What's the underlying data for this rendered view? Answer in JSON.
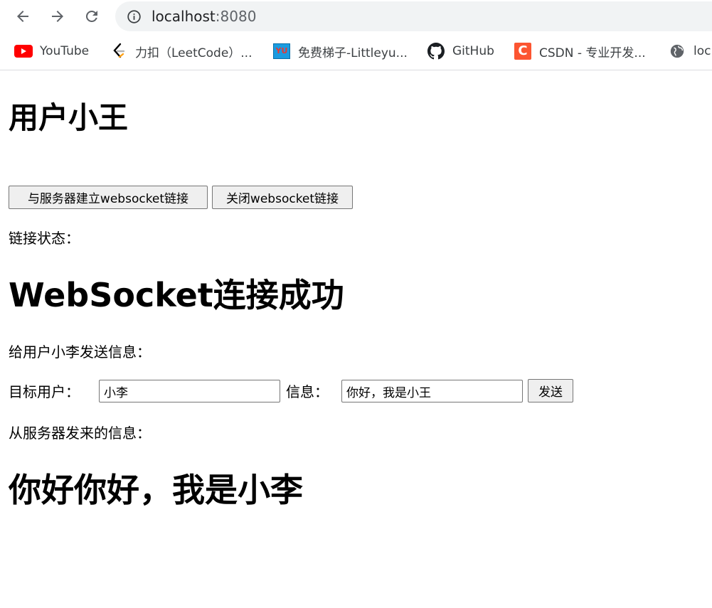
{
  "browser": {
    "url_host": "localhost",
    "url_port": ":8080",
    "bookmarks": [
      {
        "label": "YouTube",
        "icon": "youtube-icon"
      },
      {
        "label": "力扣（LeetCode）...",
        "icon": "leetcode-icon"
      },
      {
        "label": "免费梯子-Littleyu...",
        "icon": "littleyu-icon"
      },
      {
        "label": "GitHub",
        "icon": "github-icon"
      },
      {
        "label": "CSDN - 专业开发...",
        "icon": "csdn-icon"
      },
      {
        "label": "loc",
        "icon": "globe-icon"
      }
    ],
    "favicon_text": {
      "littleyu": "YU",
      "csdn": "C"
    }
  },
  "page": {
    "title": "用户小王",
    "connect_button": "与服务器建立websocket链接",
    "close_button": "关闭websocket链接",
    "status_label": "链接状态：",
    "status_value": "WebSocket连接成功",
    "send_heading": "给用户小李发送信息：",
    "target_user_label": "目标用户：",
    "target_user_value": "小李",
    "message_label": "信息：",
    "message_value": "你好，我是小王",
    "send_button": "发送",
    "received_label": "从服务器发来的信息：",
    "received_message": "你好你好，我是小李"
  }
}
